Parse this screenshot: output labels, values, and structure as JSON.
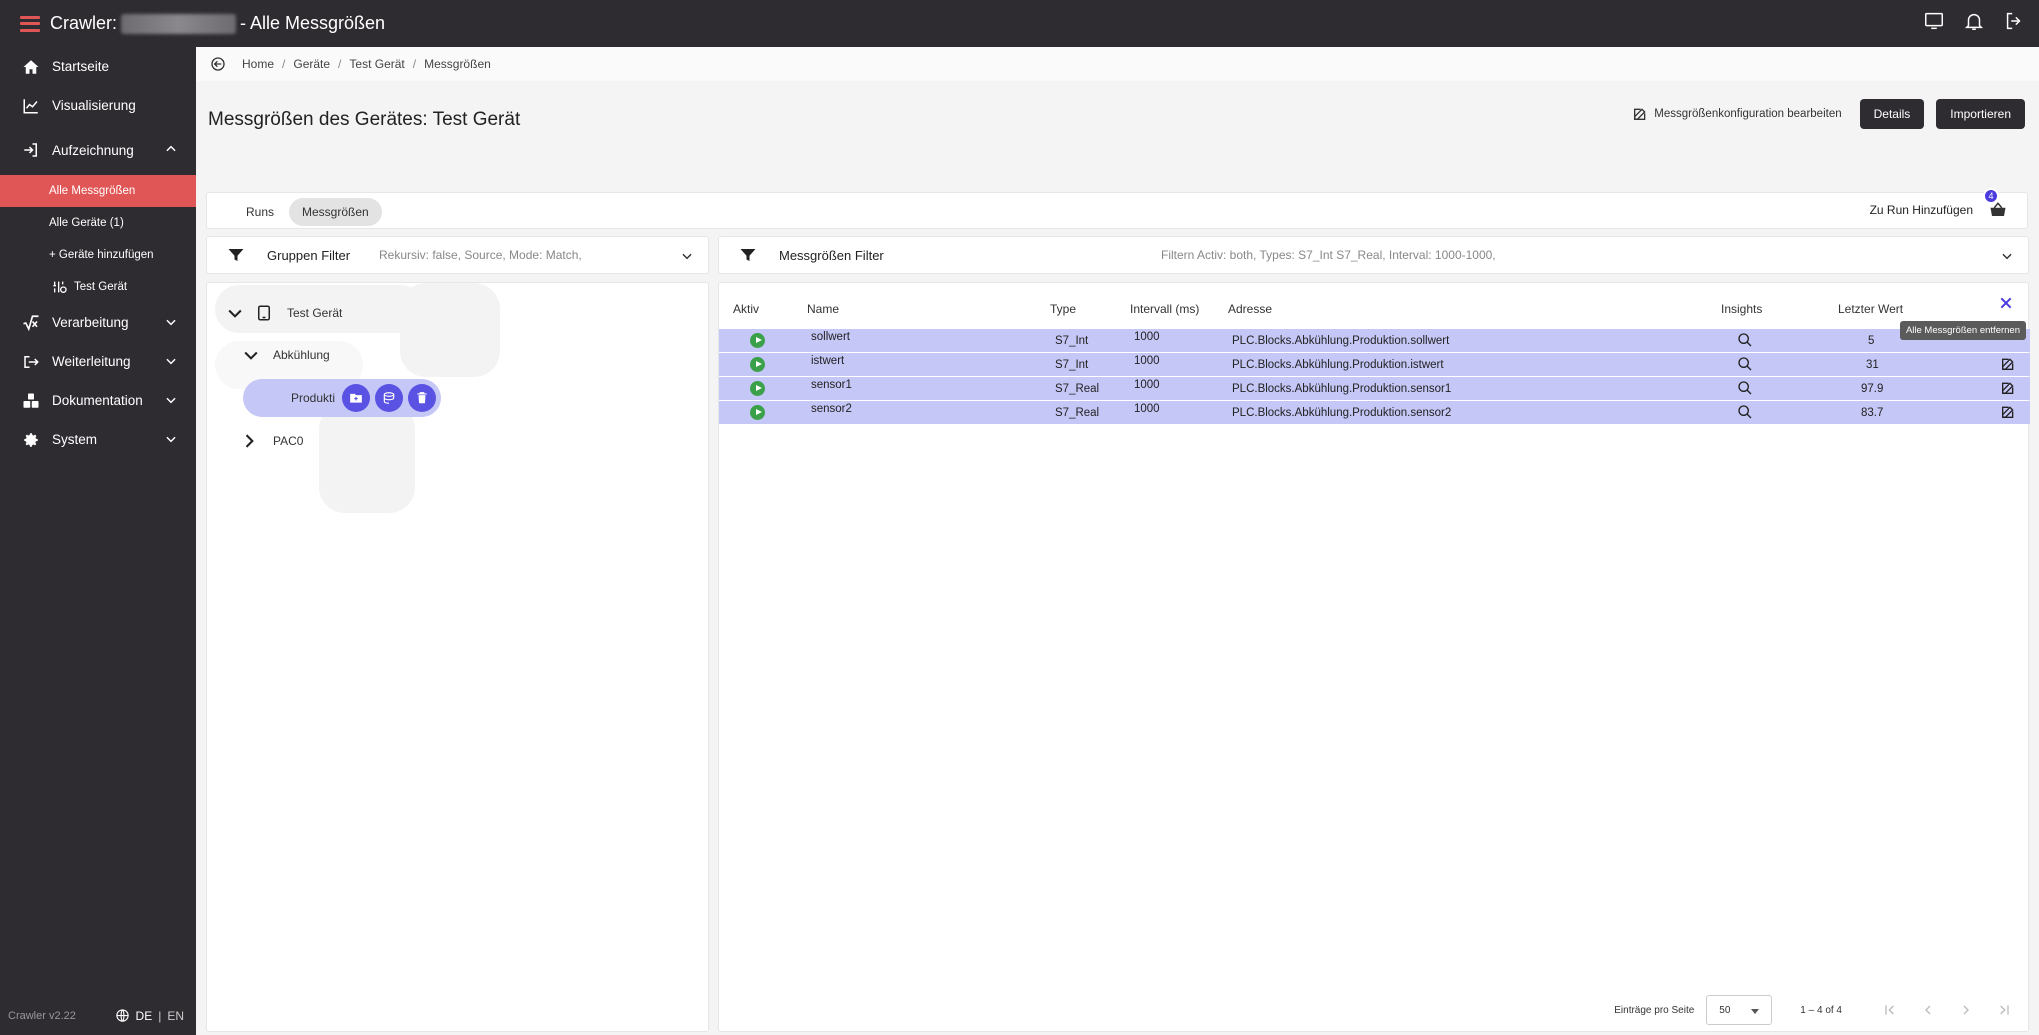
{
  "app": {
    "title_prefix": "Crawler:",
    "title_suffix": "- Alle Messgrößen",
    "version": "Crawler v2.22",
    "lang_active": "DE",
    "lang_sep": "|",
    "lang_other": "EN"
  },
  "sidebar": {
    "items": [
      {
        "label": "Startseite",
        "icon": "home-icon"
      },
      {
        "label": "Visualisierung",
        "icon": "chart-line-icon"
      },
      {
        "label": "Aufzeichnung",
        "icon": "login-arrow-icon"
      },
      {
        "label": "Verarbeitung",
        "icon": "sqrt-icon"
      },
      {
        "label": "Weiterleitung",
        "icon": "forward-icon"
      },
      {
        "label": "Dokumentation",
        "icon": "cubes-icon"
      },
      {
        "label": "System",
        "icon": "gear-icon"
      }
    ],
    "sub_items": [
      "Alle Messgrößen",
      "Alle Geräte (1)",
      "+ Geräte hinzufügen",
      "Test Gerät"
    ]
  },
  "breadcrumb": [
    "Home",
    "Geräte",
    "Test Gerät",
    "Messgrößen"
  ],
  "page": {
    "title": "Messgrößen des Gerätes: Test Gerät",
    "edit_link": "Messgrößenkonfiguration bearbeiten",
    "details_btn": "Details",
    "import_btn": "Importieren"
  },
  "tabs": {
    "runs": "Runs",
    "messgroessen": "Messgrößen",
    "add_to_run": "Zu Run Hinzufügen",
    "basket_count": "4"
  },
  "group_filter": {
    "title": "Gruppen Filter",
    "summary": "Rekursiv: false, Source, Mode: Match,"
  },
  "measure_filter": {
    "title": "Messgrößen Filter",
    "summary": "Filtern Activ: both, Types: S7_Int S7_Real, Interval: 1000-1000,"
  },
  "tree": {
    "root": "Test Gerät",
    "child": "Abkühlung",
    "selected": "Produkti",
    "other": "PAC0"
  },
  "table": {
    "headers": {
      "aktiv": "Aktiv",
      "name": "Name",
      "type": "Type",
      "interval": "Intervall (ms)",
      "address": "Adresse",
      "insights": "Insights",
      "last": "Letzter Wert"
    },
    "rows": [
      {
        "name": "sollwert",
        "type": "S7_Int",
        "interval": "1000",
        "address": "PLC.Blocks.Abkühlung.Produktion.sollwert",
        "last": "5"
      },
      {
        "name": "istwert",
        "type": "S7_Int",
        "interval": "1000",
        "address": "PLC.Blocks.Abkühlung.Produktion.istwert",
        "last": "31"
      },
      {
        "name": "sensor1",
        "type": "S7_Real",
        "interval": "1000",
        "address": "PLC.Blocks.Abkühlung.Produktion.sensor1",
        "last": "97.9"
      },
      {
        "name": "sensor2",
        "type": "S7_Real",
        "interval": "1000",
        "address": "PLC.Blocks.Abkühlung.Produktion.sensor2",
        "last": "83.7"
      }
    ],
    "tooltip": "Alle Messgrößen entfernen",
    "pager": {
      "per_page_label": "Einträge pro Seite",
      "per_page": "50",
      "range": "1 – 4 of 4"
    }
  },
  "colors": {
    "accent": "#e05656",
    "sidebar_bg": "#2f2c31",
    "row_selected": "#c5c7f7",
    "action_purple": "#5a52e3",
    "active_green": "#3aa148"
  }
}
